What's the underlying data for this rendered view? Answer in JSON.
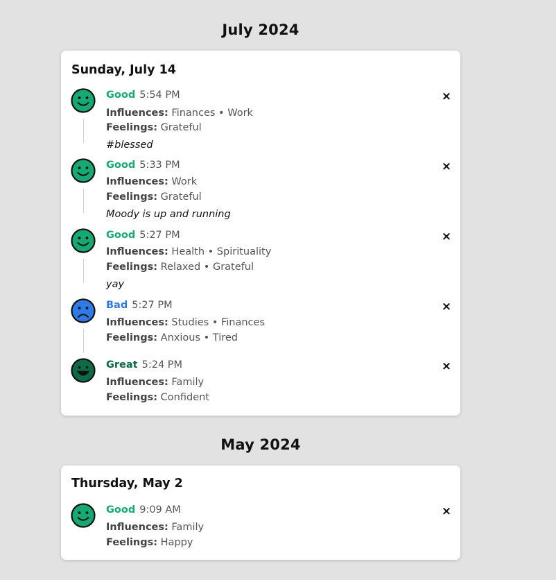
{
  "colors": {
    "page_bg": "#e2e2e2",
    "card_bg": "#ffffff",
    "good": "#16a974",
    "bad": "#2f7ae5",
    "great": "#0e6b47"
  },
  "months": [
    {
      "title": "July 2024",
      "days": [
        {
          "title": "Sunday, July 14",
          "entries": [
            {
              "mood": "Good",
              "mood_icon": "smile-face-icon",
              "time": "5:54 PM",
              "influences_label": "Influences:",
              "influences": "Finances • Work",
              "feelings_label": "Feelings:",
              "feelings": "Grateful",
              "note": "#blessed",
              "remove": "×"
            },
            {
              "mood": "Good",
              "mood_icon": "smile-face-icon",
              "time": "5:33 PM",
              "influences_label": "Influences:",
              "influences": "Work",
              "feelings_label": "Feelings:",
              "feelings": "Grateful",
              "note": "Moody is up and running",
              "remove": "×"
            },
            {
              "mood": "Good",
              "mood_icon": "smile-face-icon",
              "time": "5:27 PM",
              "influences_label": "Influences:",
              "influences": "Health • Spirituality",
              "feelings_label": "Feelings:",
              "feelings": "Relaxed • Grateful",
              "note": "yay",
              "remove": "×"
            },
            {
              "mood": "Bad",
              "mood_icon": "frown-face-icon",
              "time": "5:27 PM",
              "influences_label": "Influences:",
              "influences": "Studies • Finances",
              "feelings_label": "Feelings:",
              "feelings": "Anxious • Tired",
              "note": "",
              "remove": "×"
            },
            {
              "mood": "Great",
              "mood_icon": "grin-face-icon",
              "time": "5:24 PM",
              "influences_label": "Influences:",
              "influences": "Family",
              "feelings_label": "Feelings:",
              "feelings": "Confident",
              "note": "",
              "remove": "×"
            }
          ]
        }
      ]
    },
    {
      "title": "May 2024",
      "days": [
        {
          "title": "Thursday, May 2",
          "entries": [
            {
              "mood": "Good",
              "mood_icon": "smile-face-icon",
              "time": "9:09 AM",
              "influences_label": "Influences:",
              "influences": "Family",
              "feelings_label": "Feelings:",
              "feelings": "Happy",
              "note": "",
              "remove": "×"
            }
          ]
        }
      ]
    }
  ]
}
